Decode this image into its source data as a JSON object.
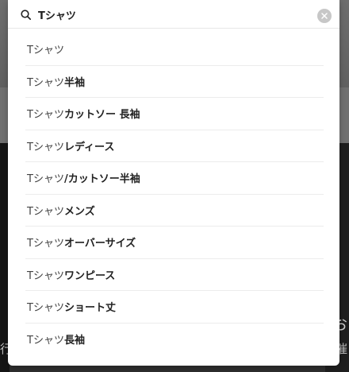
{
  "search": {
    "query": "Tシャツ",
    "clear_icon": "close-icon",
    "search_icon": "search-icon"
  },
  "suggestions": [
    {
      "query_part": "Tシャツ",
      "rest": ""
    },
    {
      "query_part": "Tシャツ",
      "rest": "半袖"
    },
    {
      "query_part": "Tシャツ",
      "rest": " カットソー 長袖"
    },
    {
      "query_part": "Tシャツ",
      "rest": " レディース"
    },
    {
      "query_part": "Tシャツ",
      "rest": "/カットソー半袖"
    },
    {
      "query_part": "Tシャツ",
      "rest": " メンズ"
    },
    {
      "query_part": "Tシャツ",
      "rest": "オーバーサイズ"
    },
    {
      "query_part": "Tシャツ",
      "rest": "ワンピース"
    },
    {
      "query_part": "Tシャツ",
      "rest": " ショート丈"
    },
    {
      "query_part": "Tシャツ",
      "rest": " 長袖"
    }
  ],
  "background": {
    "right_text_1": "お",
    "right_text_2": "催",
    "left_text_1": "行"
  },
  "colors": {
    "overlay": "#5b5b5b",
    "panel": "#ffffff",
    "clear_button": "#c7c7c7",
    "divider": "#ececec"
  }
}
